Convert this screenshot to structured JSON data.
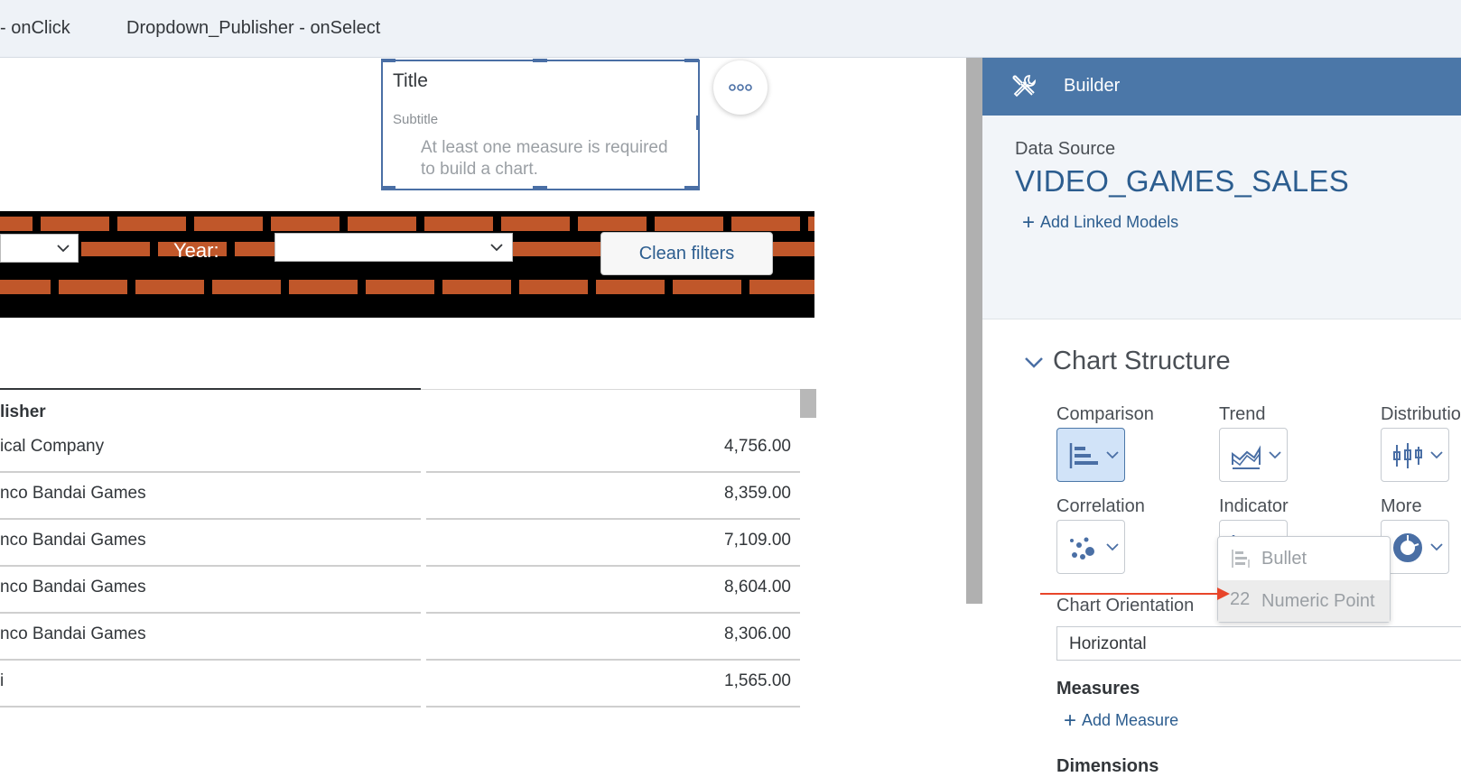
{
  "tabs": [
    {
      "label": "- onClick"
    },
    {
      "label": "Dropdown_Publisher - onSelect"
    }
  ],
  "chart_widget": {
    "title": "Title",
    "subtitle": "Subtitle",
    "message": "At least one measure is required to build a chart.",
    "more_icon": "ellipsis-icon"
  },
  "filters": {
    "year_label": "Year:",
    "clean_button": "Clean filters"
  },
  "table": {
    "column_header": "lisher",
    "rows": [
      {
        "name": "ical Company",
        "value": "4,756.00"
      },
      {
        "name": "nco Bandai Games",
        "value": "8,359.00"
      },
      {
        "name": "nco Bandai Games",
        "value": "7,109.00"
      },
      {
        "name": "nco Bandai Games",
        "value": "8,604.00"
      },
      {
        "name": "nco Bandai Games",
        "value": "8,306.00"
      },
      {
        "name": "i",
        "value": "1,565.00"
      }
    ]
  },
  "builder": {
    "title": "Builder",
    "data_source_label": "Data Source",
    "data_source_name": "VIDEO_GAMES_SALES",
    "add_linked_models": "Add Linked Models",
    "chart_structure": "Chart Structure",
    "categories": [
      {
        "label": "Comparison",
        "icon": "bar-chart-icon",
        "selected": true
      },
      {
        "label": "Trend",
        "icon": "area-chart-icon",
        "selected": false
      },
      {
        "label": "Distributio",
        "icon": "box-plot-icon",
        "selected": false
      },
      {
        "label": "Correlation",
        "icon": "scatter-icon",
        "selected": false
      },
      {
        "label": "Indicator",
        "icon": "bullet-chart-icon",
        "selected": false
      },
      {
        "label": "More",
        "icon": "donut-icon",
        "selected": false
      }
    ],
    "orientation_label": "Chart Orientation",
    "orientation_value": "Horizontal",
    "measures_label": "Measures",
    "add_measure": "Add Measure",
    "dimensions_label": "Dimensions"
  },
  "indicator_menu": {
    "items": [
      {
        "label": "Bullet",
        "icon": "bullet-icon"
      },
      {
        "label": "Numeric Point",
        "icon_text": "22",
        "hovered": true
      }
    ]
  },
  "colors": {
    "builder_header": "#4b77a8",
    "accent": "#2c5d8f",
    "brick": "#c0572a",
    "annotation_arrow": "#e8452a"
  }
}
